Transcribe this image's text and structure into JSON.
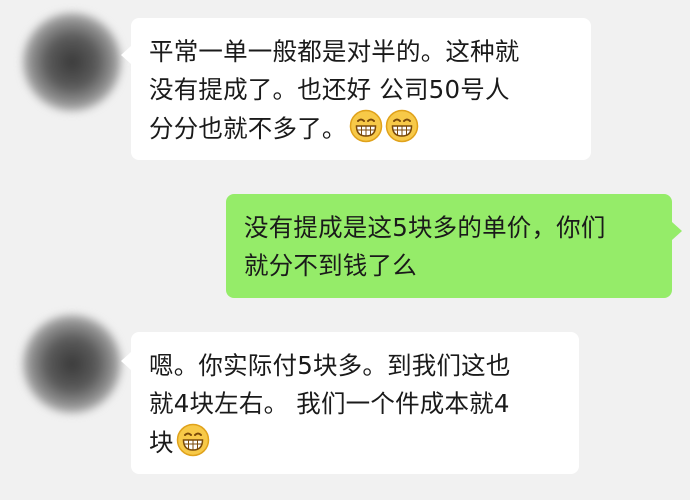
{
  "messages": [
    {
      "side": "incoming",
      "lines": [
        "平常一单一般都是对半的。这种就",
        "没有提成了。也还好 公司50号人",
        "分分也就不多了。"
      ],
      "emojis": [
        "grin-emoji",
        "grin-emoji"
      ]
    },
    {
      "side": "outgoing",
      "lines": [
        "没有提成是这5块多的单价，你们",
        "就分不到钱了么"
      ]
    },
    {
      "side": "incoming",
      "lines": [
        "嗯。你实际付5块多。到我们这也",
        "就4块左右。 我们一个件成本就4",
        "块"
      ],
      "emojis": [
        "grin-emoji"
      ]
    }
  ],
  "colors": {
    "background": "#f1f1f1",
    "incoming_bubble": "#ffffff",
    "outgoing_bubble": "#95ec69"
  }
}
